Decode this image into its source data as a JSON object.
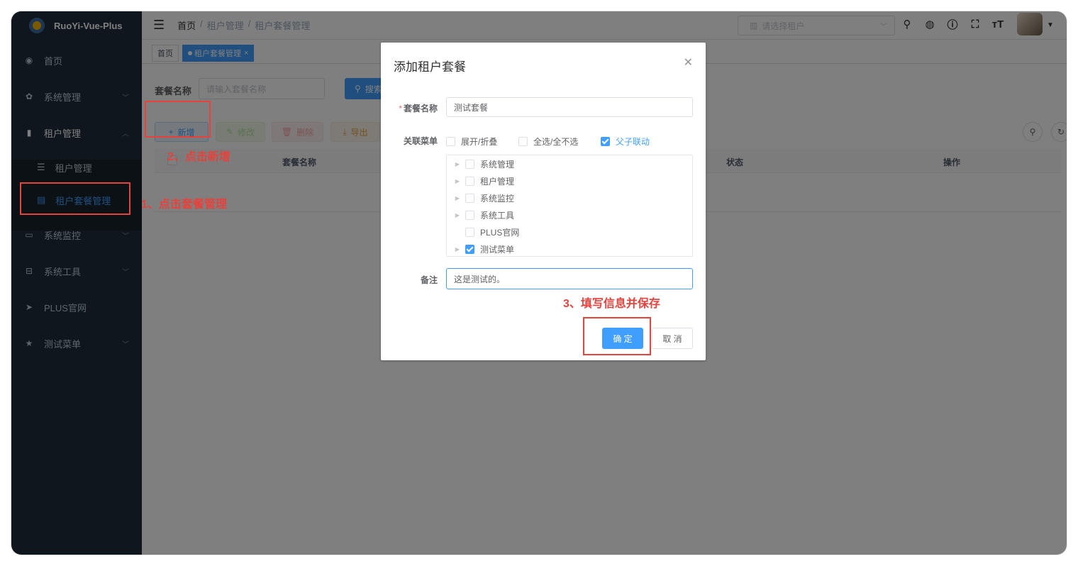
{
  "app": {
    "logo_text": "RuoYi-Vue-Plus"
  },
  "sidebar": {
    "items": [
      {
        "label": "首页",
        "icon": "dashboard-icon"
      },
      {
        "label": "系统管理",
        "icon": "gear-icon"
      },
      {
        "label": "租户管理",
        "icon": "chart-icon"
      },
      {
        "label": "系统监控",
        "icon": "monitor-icon"
      },
      {
        "label": "系统工具",
        "icon": "toolbox-icon"
      },
      {
        "label": "PLUS官网",
        "icon": "send-icon"
      },
      {
        "label": "测试菜单",
        "icon": "star-icon"
      }
    ],
    "subitems": [
      {
        "label": "租户管理",
        "icon": "list-icon"
      },
      {
        "label": "租户套餐管理",
        "icon": "document-icon",
        "active": true
      }
    ]
  },
  "navbar": {
    "breadcrumb": [
      "首页",
      "租户管理",
      "租户套餐管理"
    ],
    "tenant_placeholder": "请选择租户"
  },
  "tags": [
    {
      "label": "首页"
    },
    {
      "label": "租户套餐管理",
      "active": true
    }
  ],
  "search": {
    "label": "套餐名称",
    "placeholder": "请输入套餐名称",
    "button": "搜索"
  },
  "toolbar": {
    "add": "新增",
    "edit": "修改",
    "delete": "删除",
    "export": "导出"
  },
  "table": {
    "columns": [
      "套餐名称",
      "状态",
      "操作"
    ]
  },
  "annotations": {
    "step1": "1、点击套餐管理",
    "step2": "2、点击新增",
    "step3": "3、填写信息并保存"
  },
  "dialog": {
    "title": "添加租户套餐",
    "name_label": "套餐名称",
    "name_value": "测试套餐",
    "menu_label": "关联菜单",
    "options": [
      {
        "label": "展开/折叠",
        "checked": false
      },
      {
        "label": "全选/全不选",
        "checked": false
      },
      {
        "label": "父子联动",
        "checked": true
      }
    ],
    "tree": [
      {
        "label": "系统管理",
        "checked": false,
        "has_children": true
      },
      {
        "label": "租户管理",
        "checked": false,
        "has_children": true
      },
      {
        "label": "系统监控",
        "checked": false,
        "has_children": true
      },
      {
        "label": "系统工具",
        "checked": false,
        "has_children": true
      },
      {
        "label": "PLUS官网",
        "checked": false,
        "has_children": false
      },
      {
        "label": "测试菜单",
        "checked": true,
        "has_children": true
      }
    ],
    "remark_label": "备注",
    "remark_value": "这是测试的。",
    "ok": "确 定",
    "cancel": "取 消"
  }
}
